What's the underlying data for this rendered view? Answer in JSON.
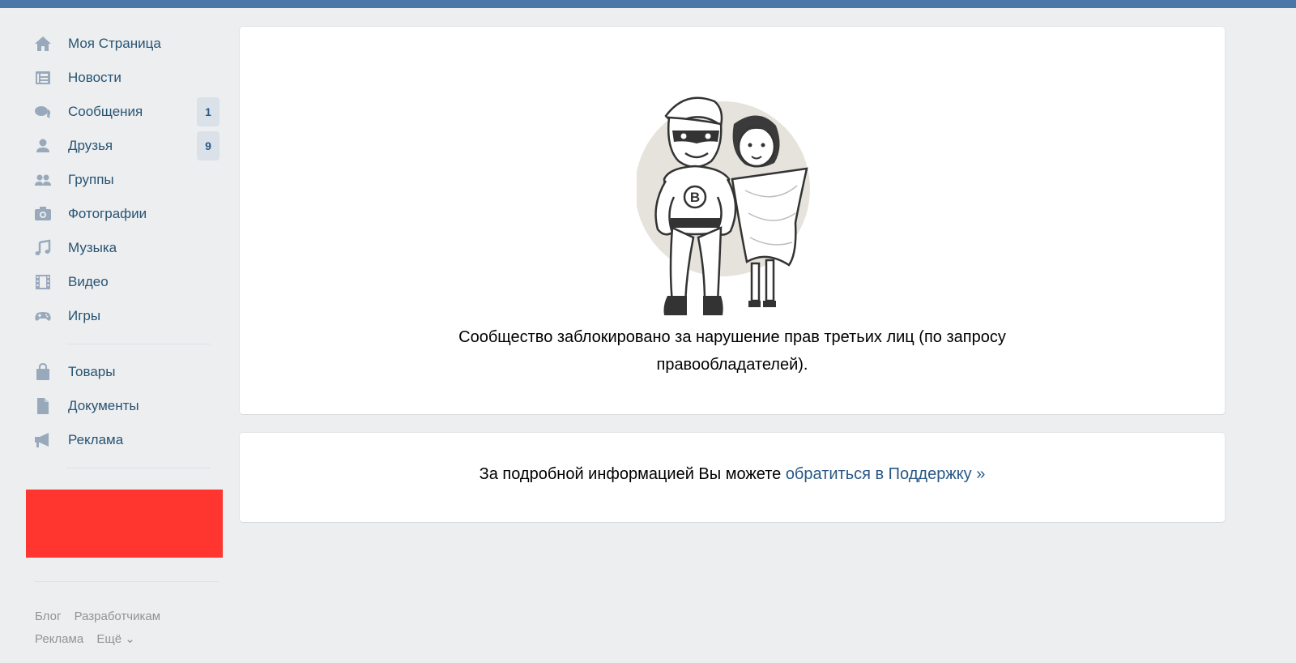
{
  "sidebar": {
    "items": [
      {
        "label": "Моя Страница",
        "icon": "home-icon"
      },
      {
        "label": "Новости",
        "icon": "news-icon"
      },
      {
        "label": "Сообщения",
        "icon": "messages-icon",
        "badge": "1"
      },
      {
        "label": "Друзья",
        "icon": "friends-icon",
        "badge": "9"
      },
      {
        "label": "Группы",
        "icon": "groups-icon"
      },
      {
        "label": "Фотографии",
        "icon": "camera-icon"
      },
      {
        "label": "Музыка",
        "icon": "music-icon"
      },
      {
        "label": "Видео",
        "icon": "video-icon"
      },
      {
        "label": "Игры",
        "icon": "games-icon"
      }
    ],
    "items2": [
      {
        "label": "Товары",
        "icon": "bag-icon"
      },
      {
        "label": "Документы",
        "icon": "document-icon"
      },
      {
        "label": "Реклама",
        "icon": "megaphone-icon"
      }
    ]
  },
  "footer": {
    "blog": "Блог",
    "developers": "Разработчикам",
    "ads": "Реклама",
    "more": "Ещё ⌄"
  },
  "main": {
    "blocked_text": "Сообщество заблокировано за нарушение прав третьих лиц (по запросу правообладателей).",
    "info_prefix": "За подробной информацией Вы можете ",
    "info_link": "обратиться в Поддержку »",
    "mascot_letter": "В"
  },
  "colors": {
    "accent": "#4a76a8",
    "link": "#2a5885",
    "sidebar_text": "#285473",
    "background": "#edeef0",
    "redaction": "#ff3630"
  }
}
